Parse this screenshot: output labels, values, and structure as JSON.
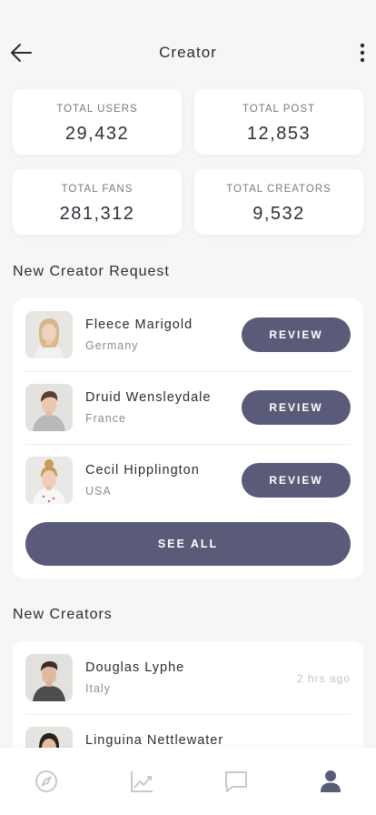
{
  "header": {
    "title": "Creator"
  },
  "stats": [
    {
      "label": "TOTAL USERS",
      "value": "29,432"
    },
    {
      "label": "TOTAL POST",
      "value": "12,853"
    },
    {
      "label": "TOTAL FANS",
      "value": "281,312"
    },
    {
      "label": "TOTAL CREATORS",
      "value": "9,532"
    }
  ],
  "requests": {
    "title": "New Creator Request",
    "items": [
      {
        "name": "Fleece Marigold",
        "country": "Germany",
        "action": "REVIEW"
      },
      {
        "name": "Druid Wensleydale",
        "country": "France",
        "action": "REVIEW"
      },
      {
        "name": "Cecil Hipplington",
        "country": "USA",
        "action": "REVIEW"
      }
    ],
    "see_all": "SEE ALL"
  },
  "new_creators": {
    "title": "New Creators",
    "items": [
      {
        "name": "Douglas Lyphe",
        "country": "Italy",
        "time": "2 hrs ago"
      },
      {
        "name": "Linguina Nettlewater",
        "country": "",
        "time": ""
      }
    ]
  },
  "bottom_nav": [
    {
      "icon": "compass-icon",
      "active": false
    },
    {
      "icon": "chart-icon",
      "active": false
    },
    {
      "icon": "chat-icon",
      "active": false
    },
    {
      "icon": "user-icon",
      "active": true
    }
  ],
  "colors": {
    "accent": "#595b78",
    "background": "#f6f6f6",
    "card": "#ffffff",
    "muted_text": "#8a8c92",
    "nav_inactive": "#c8c9cc"
  }
}
